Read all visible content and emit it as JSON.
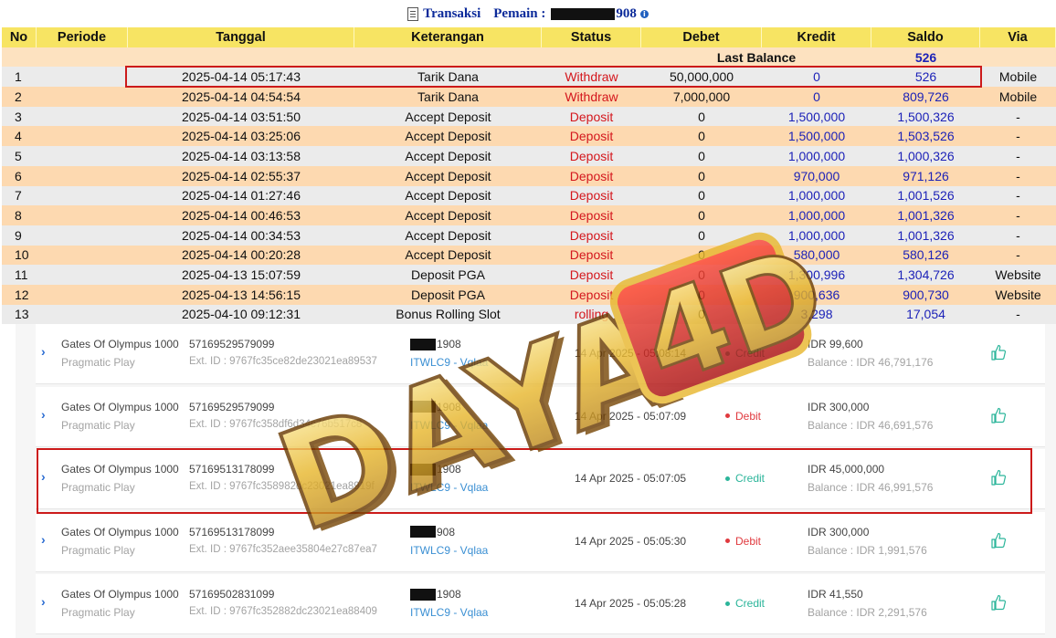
{
  "title": {
    "prefix": "Transaksi",
    "player_label": "Pemain :",
    "player_suffix": "908"
  },
  "table": {
    "headers": [
      "No",
      "Periode",
      "Tanggal",
      "Keterangan",
      "Status",
      "Debet",
      "Kredit",
      "Saldo",
      "Via"
    ],
    "last_balance_label": "Last Balance",
    "last_balance_value": "526",
    "rows": [
      {
        "no": "1",
        "periode": "",
        "tanggal": "2025-04-14 05:17:43",
        "keterangan": "Tarik Dana",
        "status": "Withdraw",
        "debet": "50,000,000",
        "kredit": "0",
        "saldo": "526",
        "via": "Mobile"
      },
      {
        "no": "2",
        "periode": "",
        "tanggal": "2025-04-14 04:54:54",
        "keterangan": "Tarik Dana",
        "status": "Withdraw",
        "debet": "7,000,000",
        "kredit": "0",
        "saldo": "809,726",
        "via": "Mobile"
      },
      {
        "no": "3",
        "periode": "",
        "tanggal": "2025-04-14 03:51:50",
        "keterangan": "Accept Deposit",
        "status": "Deposit",
        "debet": "0",
        "kredit": "1,500,000",
        "saldo": "1,500,326",
        "via": "-"
      },
      {
        "no": "4",
        "periode": "",
        "tanggal": "2025-04-14 03:25:06",
        "keterangan": "Accept Deposit",
        "status": "Deposit",
        "debet": "0",
        "kredit": "1,500,000",
        "saldo": "1,503,526",
        "via": "-"
      },
      {
        "no": "5",
        "periode": "",
        "tanggal": "2025-04-14 03:13:58",
        "keterangan": "Accept Deposit",
        "status": "Deposit",
        "debet": "0",
        "kredit": "1,000,000",
        "saldo": "1,000,326",
        "via": "-"
      },
      {
        "no": "6",
        "periode": "",
        "tanggal": "2025-04-14 02:55:37",
        "keterangan": "Accept Deposit",
        "status": "Deposit",
        "debet": "0",
        "kredit": "970,000",
        "saldo": "971,126",
        "via": "-"
      },
      {
        "no": "7",
        "periode": "",
        "tanggal": "2025-04-14 01:27:46",
        "keterangan": "Accept Deposit",
        "status": "Deposit",
        "debet": "0",
        "kredit": "1,000,000",
        "saldo": "1,001,526",
        "via": "-"
      },
      {
        "no": "8",
        "periode": "",
        "tanggal": "2025-04-14 00:46:53",
        "keterangan": "Accept Deposit",
        "status": "Deposit",
        "debet": "0",
        "kredit": "1,000,000",
        "saldo": "1,001,326",
        "via": "-"
      },
      {
        "no": "9",
        "periode": "",
        "tanggal": "2025-04-14 00:34:53",
        "keterangan": "Accept Deposit",
        "status": "Deposit",
        "debet": "0",
        "kredit": "1,000,000",
        "saldo": "1,001,326",
        "via": "-"
      },
      {
        "no": "10",
        "periode": "",
        "tanggal": "2025-04-14 00:20:28",
        "keterangan": "Accept Deposit",
        "status": "Deposit",
        "debet": "0",
        "kredit": "580,000",
        "saldo": "580,126",
        "via": "-"
      },
      {
        "no": "11",
        "periode": "",
        "tanggal": "2025-04-13 15:07:59",
        "keterangan": "Deposit PGA",
        "status": "Deposit",
        "debet": "0",
        "kredit": "1,300,996",
        "saldo": "1,304,726",
        "via": "Website"
      },
      {
        "no": "12",
        "periode": "",
        "tanggal": "2025-04-13 14:56:15",
        "keterangan": "Deposit PGA",
        "status": "Deposit",
        "debet": "0",
        "kredit": "900,636",
        "saldo": "900,730",
        "via": "Website"
      },
      {
        "no": "13",
        "periode": "",
        "tanggal": "2025-04-10 09:12:31",
        "keterangan": "Bonus Rolling Slot",
        "status": "rolling",
        "debet": "0",
        "kredit": "3,298",
        "saldo": "17,054",
        "via": "-"
      }
    ]
  },
  "bets": [
    {
      "game": "Gates Of Olympus 1000",
      "provider": "Pragmatic Play",
      "bet_id": "57169529579099",
      "ext_id": "Ext. ID : 9767fc35ce82de23021ea89537",
      "user_suffix": "1908",
      "agent": "ITWLC9 - Vqlaa",
      "datetime": "14 Apr 2025 - 05:08:14",
      "type": "Credit",
      "amount": "IDR 99,600",
      "balance": "Balance : IDR 46,791,176"
    },
    {
      "game": "Gates Of Olympus 1000",
      "provider": "Pragmatic Play",
      "bet_id": "57169529579099",
      "ext_id": "Ext. ID : 9767fc358df6d34c76b517c8",
      "user_suffix": "1908",
      "agent": "ITWLC9 - Vqlaa",
      "datetime": "14 Apr 2025 - 05:07:09",
      "type": "Debit",
      "amount": "IDR 300,000",
      "balance": "Balance : IDR 46,691,576"
    },
    {
      "game": "Gates Of Olympus 1000",
      "provider": "Pragmatic Play",
      "bet_id": "57169513178099",
      "ext_id": "Ext. ID : 9767fc358982dc23021ea8919f",
      "user_suffix": "1908",
      "agent": "ITWLC9 - Vqlaa",
      "datetime": "14 Apr 2025 - 05:07:05",
      "type": "Credit",
      "amount": "IDR 45,000,000",
      "balance": "Balance : IDR 46,991,576"
    },
    {
      "game": "Gates Of Olympus 1000",
      "provider": "Pragmatic Play",
      "bet_id": "57169513178099",
      "ext_id": "Ext. ID : 9767fc352aee35804e27c87ea7",
      "user_suffix": "908",
      "agent": "ITWLC9 - Vqlaa",
      "datetime": "14 Apr 2025 - 05:05:30",
      "type": "Debit",
      "amount": "IDR 300,000",
      "balance": "Balance : IDR 1,991,576"
    },
    {
      "game": "Gates Of Olympus 1000",
      "provider": "Pragmatic Play",
      "bet_id": "57169502831099",
      "ext_id": "Ext. ID : 9767fc352882dc23021ea88409",
      "user_suffix": "1908",
      "agent": "ITWLC9 - Vqlaa",
      "datetime": "14 Apr 2025 - 05:05:28",
      "type": "Credit",
      "amount": "IDR 41,550",
      "balance": "Balance : IDR 2,291,576"
    }
  ],
  "watermark_text": "DAYA 4D",
  "colors": {
    "header_bg": "#f7e463",
    "row_odd": "#ebebeb",
    "row_even": "#fdd9b0",
    "status_red": "#d4161c",
    "value_blue": "#1c22b8",
    "credit_green": "#2bb59a",
    "debit_red": "#e0393e",
    "highlight_red": "#cc1a1a",
    "watermark_gold": "#e8b830",
    "watermark_red": "#d01818"
  },
  "icons": {
    "title": "document-icon",
    "info": "info-icon",
    "row_expand": "chevron-right-icon",
    "like": "thumbs-up-icon"
  }
}
